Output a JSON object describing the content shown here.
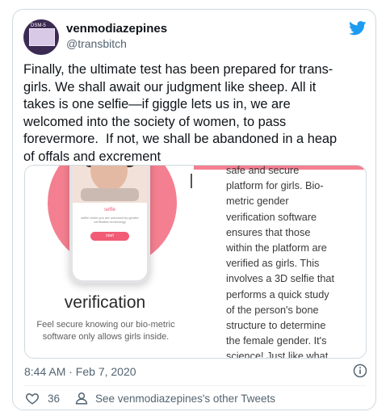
{
  "header": {
    "display_name": "venmodiazepines",
    "handle": "@transbitch",
    "avatar_text": "DSM-5"
  },
  "tweet": {
    "text": "Finally, the ultimate test has been prepared for trans-\ngirls. We shall await our judgment like sheep. All it\ntakes is one selfie—if giggle lets us in, we are\nwelcomed into the society of women, to pass\nforevermore.  If not, we shall be abandoned in a heap\nof offals and excrement"
  },
  "media": {
    "phone": {
      "selfie_label": "selfie",
      "selfie_sub": "selfie! when you are unlocked by gender verification technology",
      "button_label": "start"
    },
    "verification_title": "verification",
    "left_caption": "Feel secure knowing our bio-metric\nsoftware only allows girls inside.",
    "right_text": "safe and secure\nplatform for girls. Bio-\nmetric gender\nverification software\nensures that those\nwithin the platform are\nverified as girls. This\ninvolves a 3D selfie that\nperforms a quick study\nof the person's bone\nstructure to determine\nthe female gender. It's\nscience! Just like what"
  },
  "footer": {
    "timestamp": "8:44 AM · Feb 7, 2020",
    "likes": "36",
    "other_tweets": "See venmodiazepines's other Tweets"
  },
  "colors": {
    "accent_pink": "#f47f90",
    "twitter_blue": "#1d9bf0",
    "muted": "#536471"
  }
}
